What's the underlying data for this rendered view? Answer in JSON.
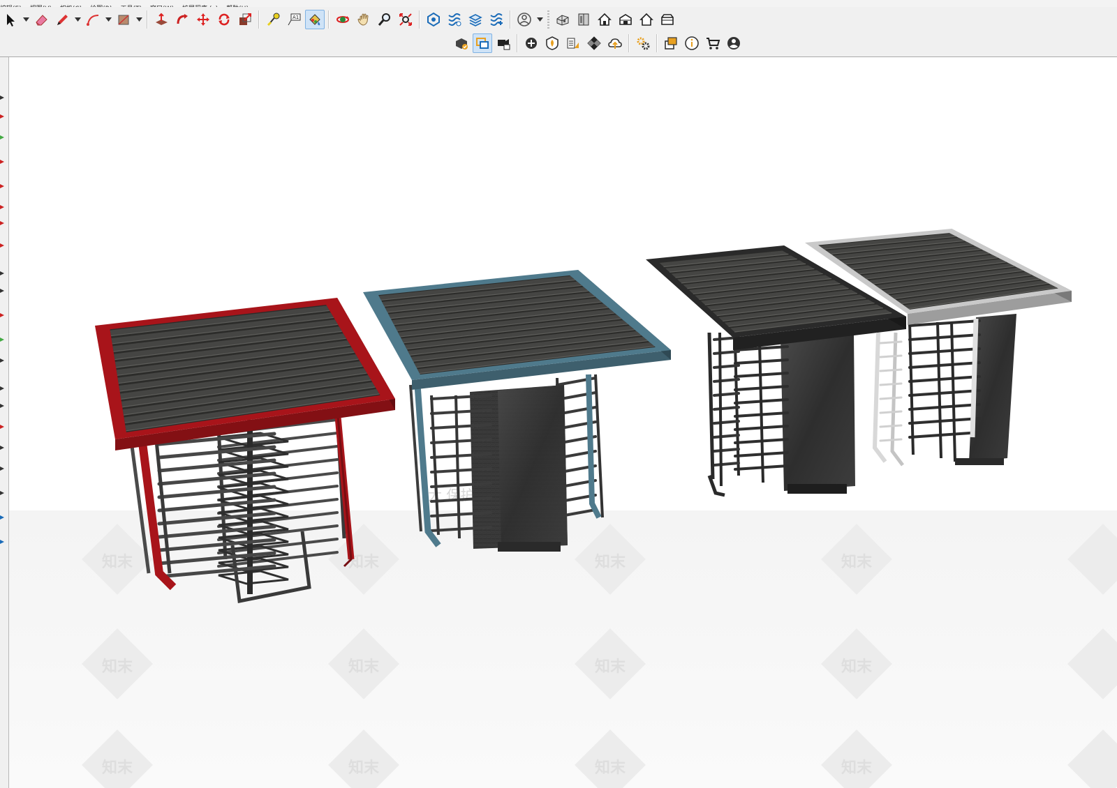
{
  "menu": {
    "items": [
      "编辑(E)",
      "视图(V)",
      "相机(C)",
      "绘图(R)",
      "工具(T)",
      "窗口(W)",
      "扩展程序 (x)",
      "帮助(H)"
    ]
  },
  "toolbar_row1": [
    {
      "name": "select-tool",
      "icon": "arrow-cursor-icon",
      "dropdown": true
    },
    {
      "name": "eraser-tool",
      "icon": "eraser-icon",
      "dropdown": false
    },
    {
      "name": "line-tool",
      "icon": "pencil-icon",
      "dropdown": true
    },
    {
      "name": "arc-tool",
      "icon": "arc-icon",
      "dropdown": true
    },
    {
      "name": "rectangle-tool",
      "icon": "rectangle-icon",
      "dropdown": true
    },
    {
      "name": "push-pull-tool",
      "icon": "push-pull-icon",
      "dropdown": false
    },
    {
      "name": "follow-me-tool",
      "icon": "follow-me-icon",
      "dropdown": false
    },
    {
      "name": "move-tool",
      "icon": "move-arrows-icon",
      "dropdown": false
    },
    {
      "name": "rotate-tool",
      "icon": "rotate-icon",
      "dropdown": false
    },
    {
      "name": "scale-tool",
      "icon": "scale-icon",
      "dropdown": false
    },
    {
      "name": "tape-measure-tool",
      "icon": "tape-measure-icon",
      "dropdown": false
    },
    {
      "name": "text-tool",
      "icon": "text-label-icon",
      "dropdown": false
    },
    {
      "name": "paint-bucket-tool",
      "icon": "paint-bucket-icon",
      "dropdown": false,
      "active": true
    },
    {
      "name": "orbit-tool",
      "icon": "orbit-icon",
      "dropdown": false
    },
    {
      "name": "pan-tool",
      "icon": "hand-icon",
      "dropdown": false
    },
    {
      "name": "zoom-tool",
      "icon": "magnifier-icon",
      "dropdown": false
    },
    {
      "name": "zoom-extents-tool",
      "icon": "zoom-extents-icon",
      "dropdown": false
    },
    {
      "name": "warehouse-button",
      "icon": "warehouse-icon",
      "dropdown": false
    },
    {
      "name": "extension-warehouse-button",
      "icon": "extension-warehouse-icon",
      "dropdown": false
    },
    {
      "name": "layers-button",
      "icon": "layers-stack-icon",
      "dropdown": false
    },
    {
      "name": "extension-manager-button",
      "icon": "extension-manager-icon",
      "dropdown": false
    },
    {
      "name": "account-button",
      "icon": "user-circle-icon",
      "dropdown": true
    },
    {
      "name": "iso-view-button",
      "icon": "iso-house-icon",
      "dropdown": false
    },
    {
      "name": "top-view-button",
      "icon": "top-view-icon",
      "dropdown": false
    },
    {
      "name": "front-view-button",
      "icon": "front-house-icon",
      "dropdown": false
    },
    {
      "name": "right-view-button",
      "icon": "right-house-icon",
      "dropdown": false
    },
    {
      "name": "back-view-button",
      "icon": "back-house-icon",
      "dropdown": false
    },
    {
      "name": "left-view-button",
      "icon": "left-house-icon",
      "dropdown": false
    }
  ],
  "toolbar_row2": [
    {
      "name": "component-button",
      "icon": "component-check-icon",
      "active": false
    },
    {
      "name": "section-button",
      "icon": "section-plane-icon",
      "active": true
    },
    {
      "name": "camera-button",
      "icon": "camera-icon",
      "active": false
    },
    {
      "name": "add-location-button",
      "icon": "add-circle-icon",
      "active": false
    },
    {
      "name": "geo-button",
      "icon": "shield-geo-icon",
      "active": false
    },
    {
      "name": "texture-button",
      "icon": "texture-icon",
      "active": false
    },
    {
      "name": "checker-button",
      "icon": "checkerboard-icon",
      "active": false
    },
    {
      "name": "cloud-upload-button",
      "icon": "cloud-upload-icon",
      "active": false
    },
    {
      "name": "settings-button",
      "icon": "gears-icon",
      "active": false
    },
    {
      "name": "model-info-button",
      "icon": "chat-windows-icon",
      "active": false
    },
    {
      "name": "info-button",
      "icon": "info-icon",
      "active": false
    },
    {
      "name": "cart-button",
      "icon": "cart-icon",
      "active": false
    },
    {
      "name": "profile-button",
      "icon": "profile-icon",
      "active": false
    }
  ],
  "viewport": {
    "watermark_text": "知末",
    "watermark_overlay": "大  保护区  画质会压缩"
  },
  "colors": {
    "red_frame": "#a8141a",
    "blue_frame": "#4f7a8c",
    "black_frame": "#2a2a2a",
    "silver_frame": "#c9c9c9",
    "slat": "#3c3c3a",
    "ground": "#f4f4f4"
  }
}
